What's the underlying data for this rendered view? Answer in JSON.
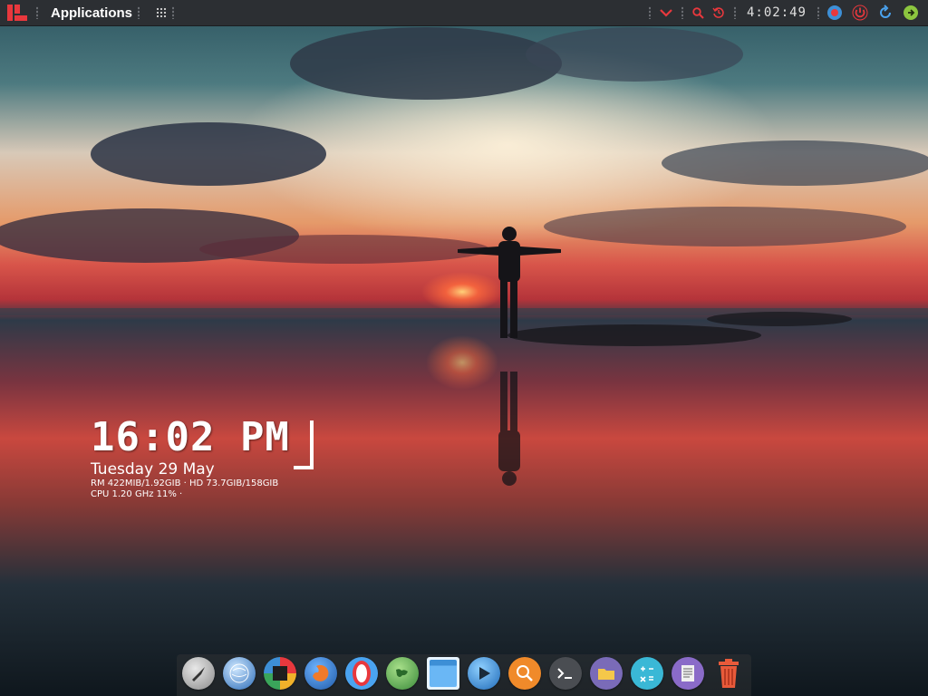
{
  "panel": {
    "menu_label": "Applications",
    "clock_digital": "4:02:49"
  },
  "desktop": {
    "time": "16:02 PM",
    "date": "Tuesday 29 May",
    "stats_line1": "RM 422MIB/1.92GIB · HD 73.7GIB/158GIB",
    "stats_line2": "CPU 1.20 GHz 11% ·"
  },
  "dock": {
    "items": [
      "launcher-icon",
      "globe-icon",
      "app-icon",
      "firefox-icon",
      "opera-icon",
      "browser-icon",
      "window-icon",
      "media-icon",
      "search-icon",
      "terminal-icon",
      "files-icon",
      "calculator-icon",
      "text-editor-icon",
      "trash-icon"
    ]
  },
  "colors": {
    "panel_bg": "#2c2f33",
    "accent_red": "#e8383d"
  }
}
